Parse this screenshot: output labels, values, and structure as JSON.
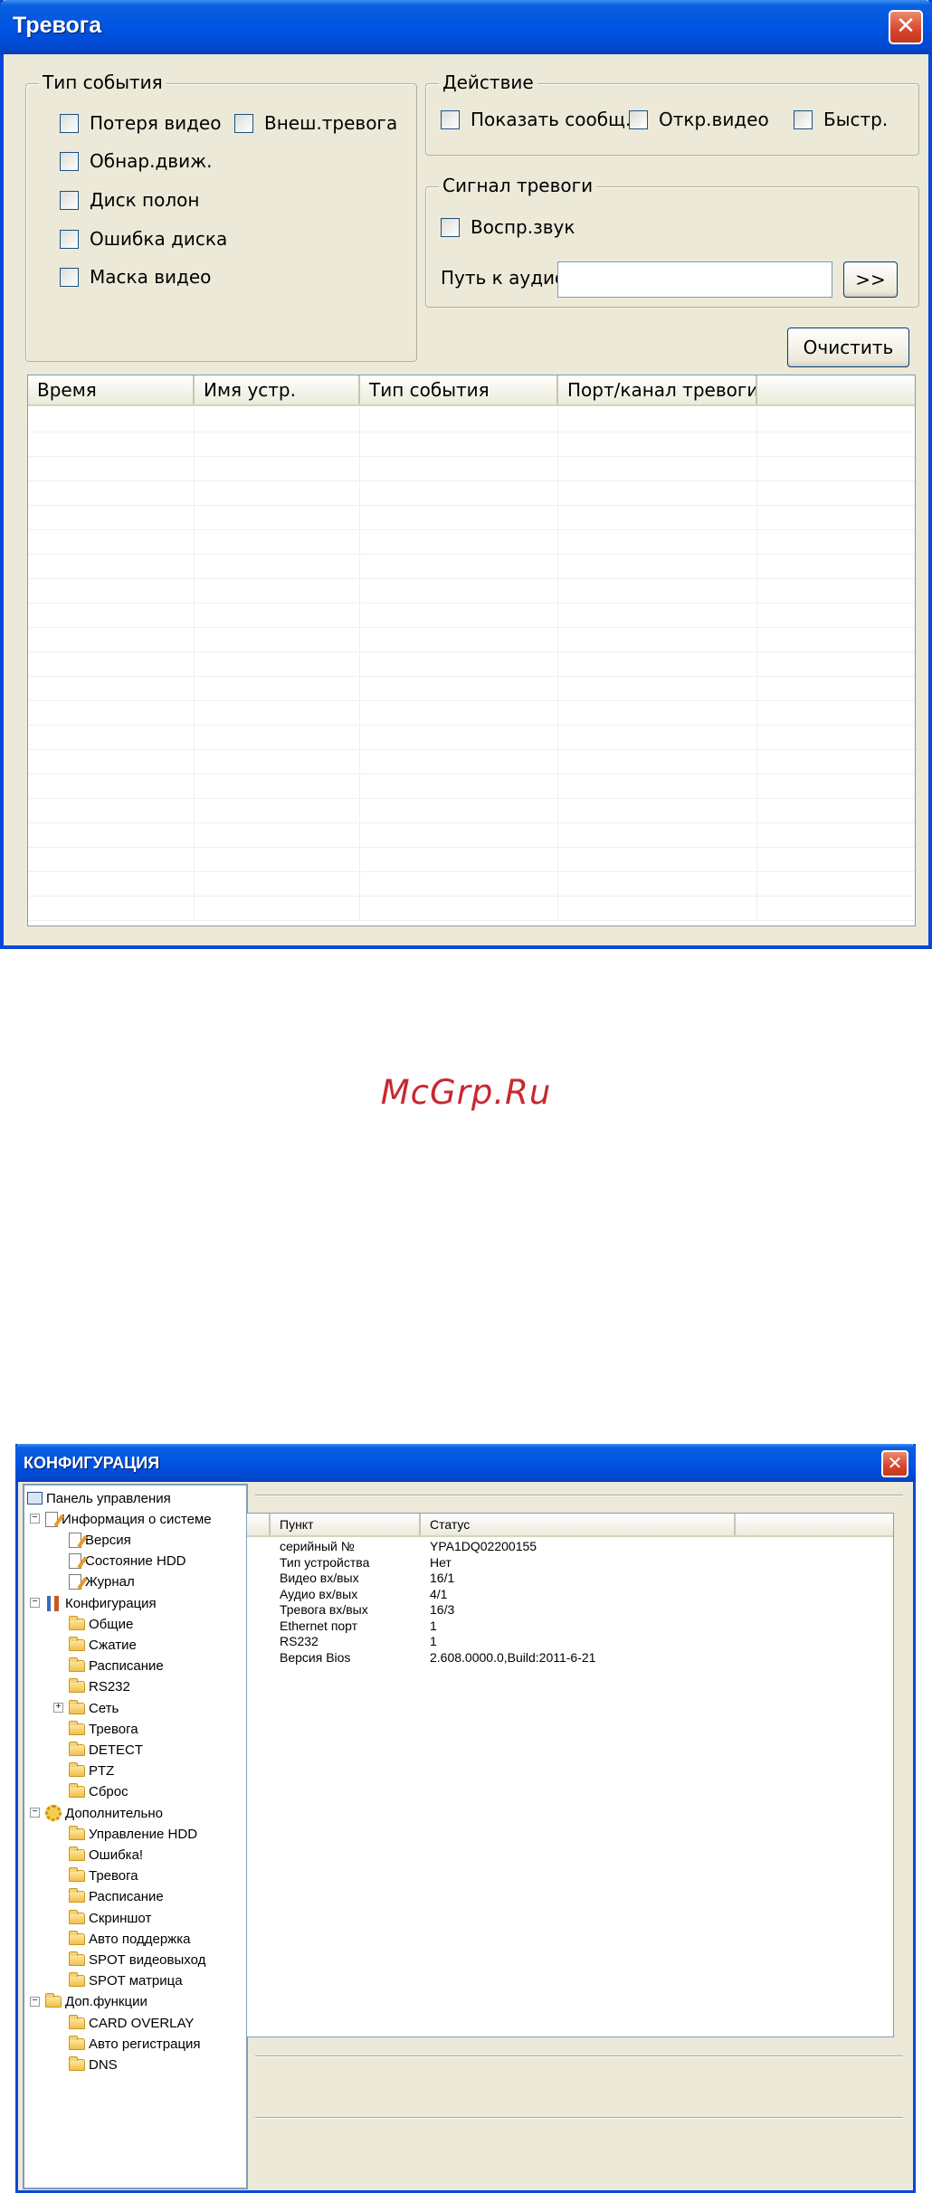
{
  "alarm_window": {
    "title": "Тревога",
    "event_type": {
      "title": "Тип события",
      "options": [
        "Потеря видео",
        "Обнар.движ.",
        "Диск полон",
        "Ошибка диска",
        "Маска видео"
      ],
      "external_alarm": "Внеш.тревога"
    },
    "action": {
      "title": "Действие",
      "options": [
        "Показать сообщ.",
        "Откр.видео",
        "Быстр."
      ]
    },
    "alarm_signal": {
      "title": "Сигнал тревоги",
      "play_sound": "Воспр.звук",
      "audio_path_label": "Путь к аудио",
      "audio_path_value": "",
      "browse_label": ">>"
    },
    "clear_label": "Очистить",
    "columns": [
      "Время",
      "Имя устр.",
      "Тип события",
      "Порт/канал тревоги",
      ""
    ]
  },
  "watermark": "McGrp.Ru",
  "config_window": {
    "title": "КОНФИГУРАЦИЯ",
    "tree": {
      "root": "Панель управления",
      "groups": [
        {
          "label": "Информация о системе",
          "icon": "edit-icon",
          "items": [
            "Версия",
            "Состояние HDD",
            "Журнал"
          ]
        },
        {
          "label": "Конфигурация",
          "icon": "tools-icon",
          "items": [
            "Общие",
            "Сжатие",
            "Расписание",
            "RS232",
            "Сеть",
            "Тревога",
            "DETECT",
            "PTZ",
            "Сброс"
          ]
        },
        {
          "label": "Дополнительно",
          "icon": "gear-icon",
          "items": [
            "Управление HDD",
            "Ошибка!",
            "Тревога",
            "Расписание",
            "Скриншот",
            "Авто поддержка",
            "SPOT видеовыход",
            "SPOT матрица"
          ]
        },
        {
          "label": "Доп.функции",
          "icon": "folder-icon",
          "items": [
            "CARD OVERLAY",
            "Авто регистрация",
            "DNS"
          ]
        }
      ]
    },
    "table": {
      "columns": [
        "Пункт",
        "Статус"
      ],
      "rows": [
        [
          "серийный №",
          "YPA1DQ02200155"
        ],
        [
          "Тип устройства",
          "Нет"
        ],
        [
          "Видео вх/вых",
          "16/1"
        ],
        [
          "Аудио вх/вых",
          "4/1"
        ],
        [
          "Тревога вх/вых",
          "16/3"
        ],
        [
          "Ethernet порт",
          "1"
        ],
        [
          "RS232",
          "1"
        ],
        [
          "Версия Bios",
          "2.608.0000.0,Build:2011-6-21"
        ]
      ]
    }
  }
}
